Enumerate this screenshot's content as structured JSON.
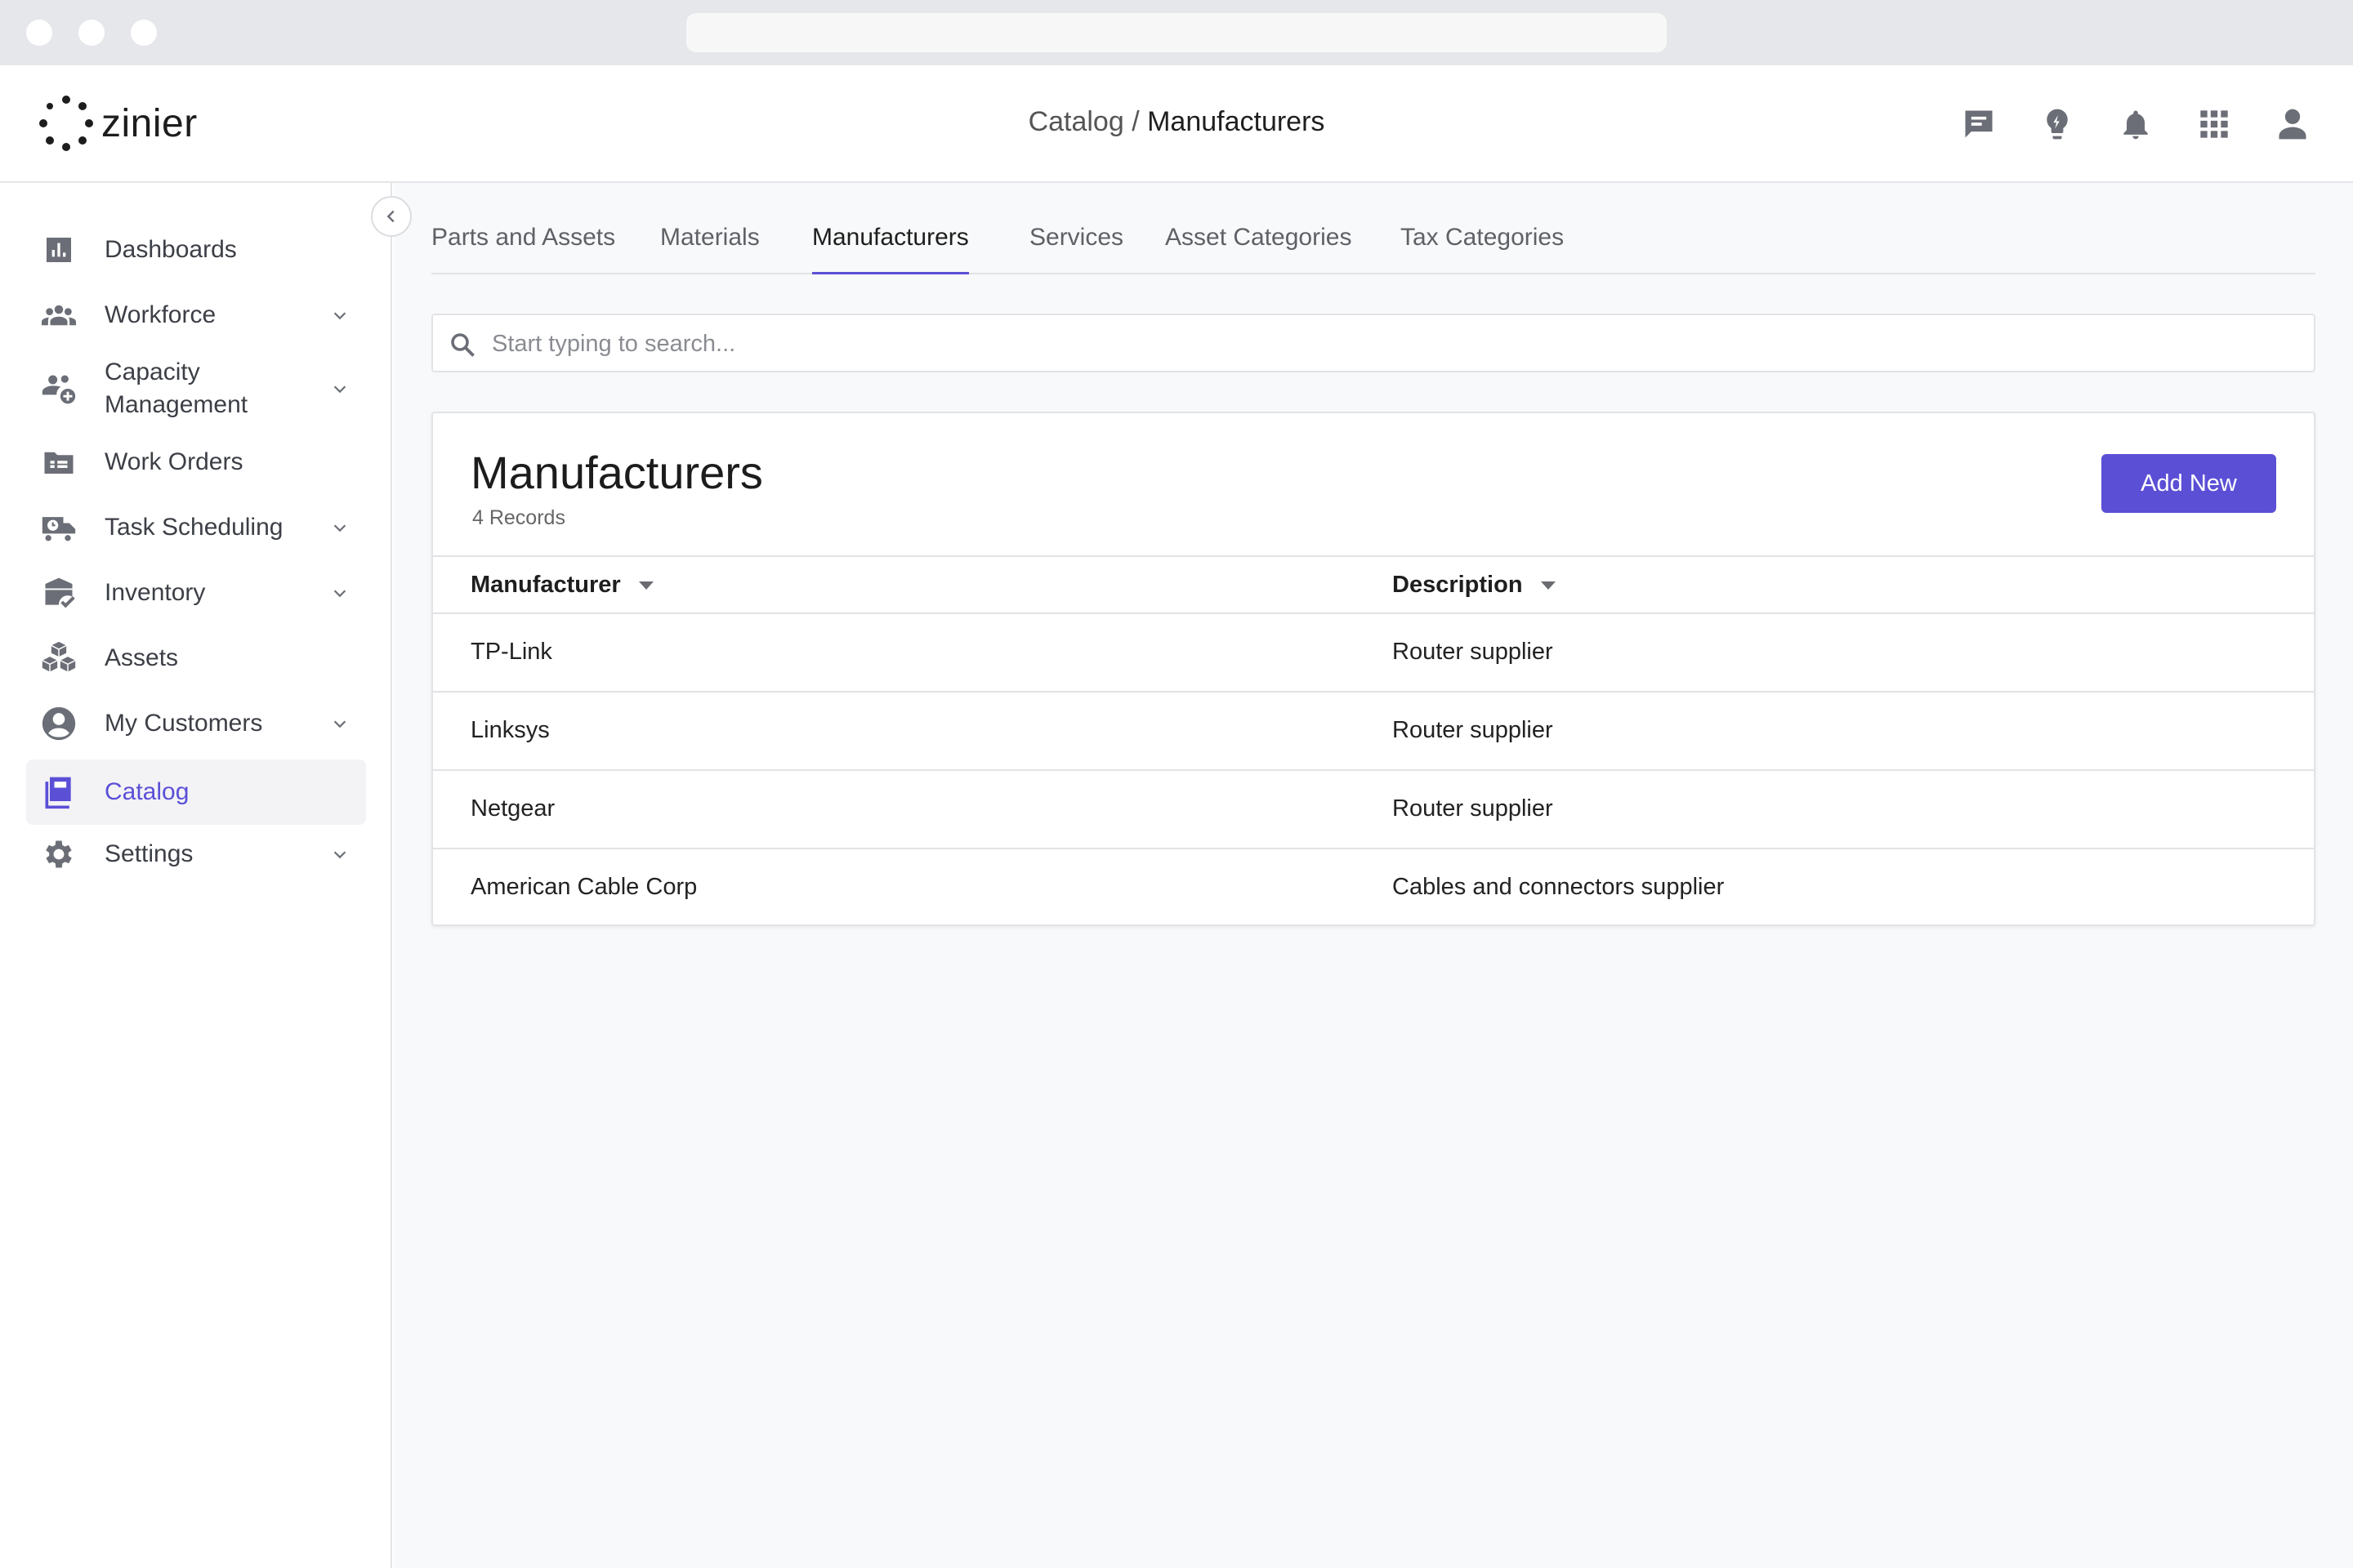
{
  "app": {
    "logo_text": "zinier",
    "breadcrumb": {
      "parent": "Catalog / ",
      "current": "Manufacturers"
    }
  },
  "top_icons": [
    "chat-icon",
    "lightbulb-icon",
    "bell-icon",
    "apps-grid-icon",
    "user-icon"
  ],
  "sidebar": {
    "items": [
      {
        "label": "Dashboards",
        "icon": "bar-chart-icon",
        "has_children": false,
        "active": false
      },
      {
        "label": "Workforce",
        "icon": "people-icon",
        "has_children": true,
        "active": false
      },
      {
        "label": "Capacity\nManagement",
        "icon": "capacity-icon",
        "has_children": true,
        "active": false
      },
      {
        "label": "Work Orders",
        "icon": "work-order-icon",
        "has_children": false,
        "active": false
      },
      {
        "label": "Task Scheduling",
        "icon": "truck-clock-icon",
        "has_children": true,
        "active": false
      },
      {
        "label": "Inventory",
        "icon": "inventory-icon",
        "has_children": true,
        "active": false
      },
      {
        "label": "Assets",
        "icon": "boxes-icon",
        "has_children": false,
        "active": false
      },
      {
        "label": "My Customers",
        "icon": "account-circle-icon",
        "has_children": true,
        "active": false
      },
      {
        "label": "Catalog",
        "icon": "catalog-book-icon",
        "has_children": false,
        "active": true
      },
      {
        "label": "Settings",
        "icon": "gear-icon",
        "has_children": true,
        "active": false
      }
    ]
  },
  "tabs": [
    {
      "label": "Parts and Assets",
      "active": false
    },
    {
      "label": "Materials",
      "active": false
    },
    {
      "label": "Manufacturers",
      "active": true
    },
    {
      "label": "Services",
      "active": false
    },
    {
      "label": "Asset Categories",
      "active": false
    },
    {
      "label": "Tax Categories",
      "active": false
    }
  ],
  "search": {
    "placeholder": "Start typing to search...",
    "value": ""
  },
  "card": {
    "title": "Manufacturers",
    "record_count": "4 Records",
    "add_button": "Add New"
  },
  "table": {
    "columns": [
      "Manufacturer",
      "Description"
    ],
    "rows": [
      [
        "TP-Link",
        "Router supplier"
      ],
      [
        "Linksys",
        "Router supplier"
      ],
      [
        "Netgear",
        "Router supplier"
      ],
      [
        "American Cable Corp",
        "Cables and connectors supplier"
      ]
    ]
  },
  "colors": {
    "accent": "#5b4fd6",
    "icon_gray": "#6b6e76",
    "background": "#f8f9fa"
  }
}
